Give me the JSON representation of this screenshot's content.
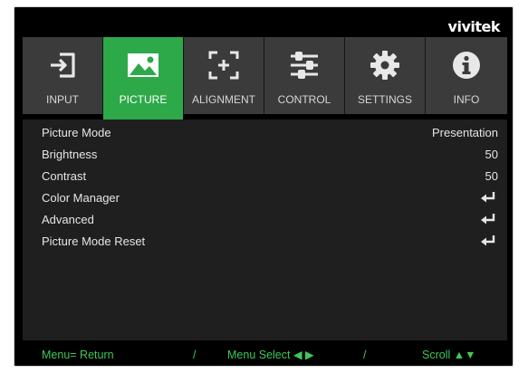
{
  "brand": "vivitek",
  "tabs": [
    {
      "label": "INPUT",
      "icon": "input-icon",
      "active": false
    },
    {
      "label": "PICTURE",
      "icon": "picture-icon",
      "active": true
    },
    {
      "label": "ALIGNMENT",
      "icon": "alignment-icon",
      "active": false
    },
    {
      "label": "CONTROL",
      "icon": "sliders-icon",
      "active": false
    },
    {
      "label": "SETTINGS",
      "icon": "gear-icon",
      "active": false
    },
    {
      "label": "INFO",
      "icon": "info-icon",
      "active": false
    }
  ],
  "menu": [
    {
      "name": "Picture Mode",
      "value": "Presentation"
    },
    {
      "name": "Brightness",
      "value": "50"
    },
    {
      "name": "Contrast",
      "value": "50"
    },
    {
      "name": "Color Manager",
      "value": "enter-icon"
    },
    {
      "name": "Advanced",
      "value": "enter-icon"
    },
    {
      "name": "Picture Mode Reset",
      "value": "enter-icon"
    }
  ],
  "footer": {
    "return": "Menu= Return",
    "sep1": "/",
    "select": "Menu Select ◀ ▶",
    "sep2": "/",
    "scroll": "Scroll ▲▼"
  },
  "colors": {
    "accent": "#2da94a",
    "footer": "#3fc85a",
    "tabbar": "#3b3b3b",
    "panel": "#1f1f1f"
  }
}
